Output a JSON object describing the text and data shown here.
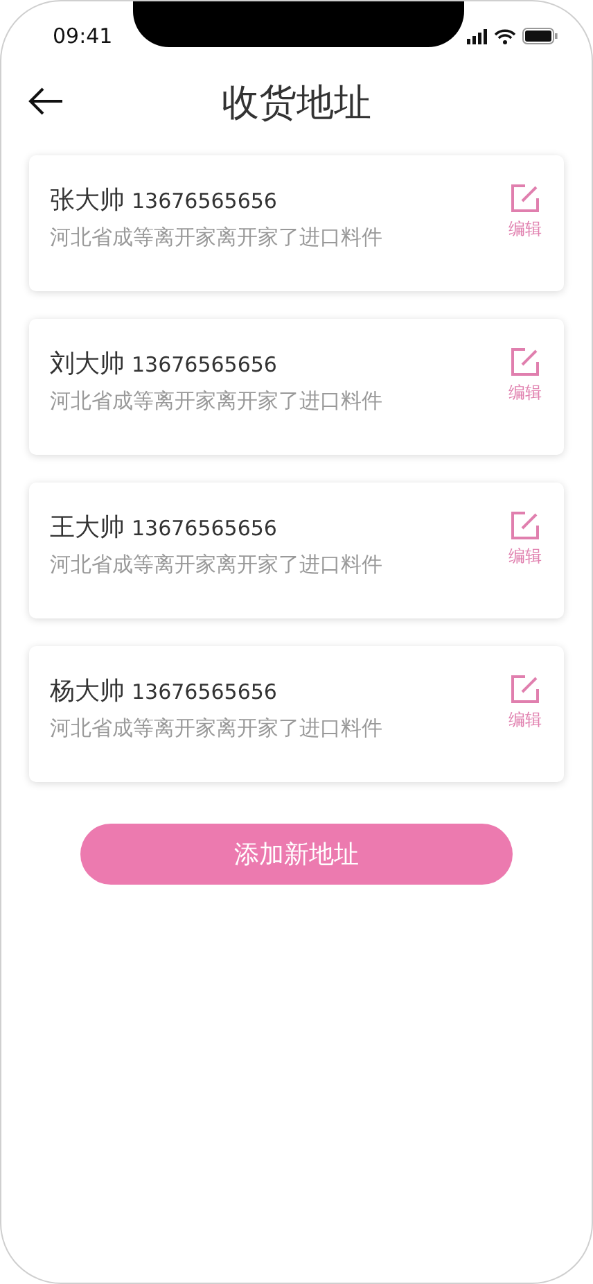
{
  "status_bar": {
    "time": "09:41"
  },
  "header": {
    "title": "收货地址"
  },
  "addresses": [
    {
      "name": "张大帅",
      "phone": "13676565656",
      "address": "河北省成等离开家离开家了进口料件",
      "edit_label": "编辑"
    },
    {
      "name": "刘大帅",
      "phone": "13676565656",
      "address": "河北省成等离开家离开家了进口料件",
      "edit_label": "编辑"
    },
    {
      "name": "王大帅",
      "phone": "13676565656",
      "address": "河北省成等离开家离开家了进口料件",
      "edit_label": "编辑"
    },
    {
      "name": "杨大帅",
      "phone": "13676565656",
      "address": "河北省成等离开家离开家了进口料件",
      "edit_label": "编辑"
    }
  ],
  "add_button": {
    "label": "添加新地址"
  }
}
